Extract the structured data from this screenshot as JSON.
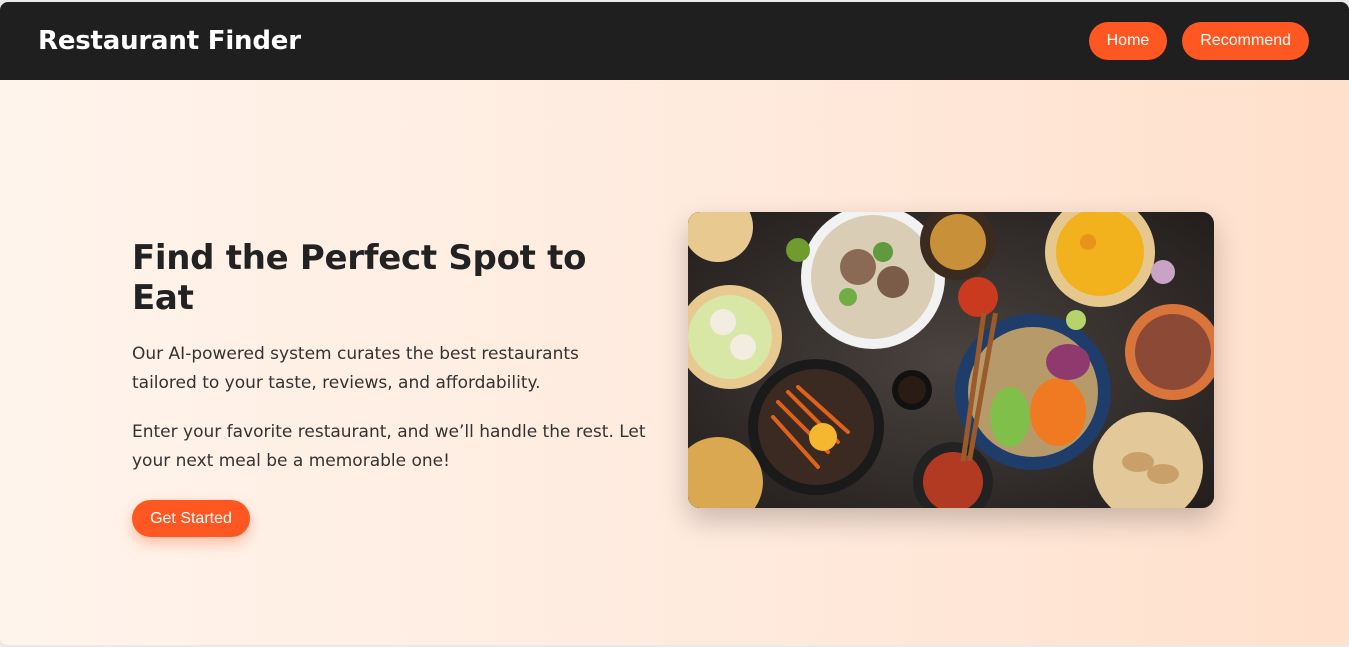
{
  "header": {
    "brand": "Restaurant Finder",
    "nav": [
      {
        "label": "Home"
      },
      {
        "label": "Recommend"
      }
    ]
  },
  "hero": {
    "title": "Find the Perfect Spot to Eat",
    "paragraphs": [
      "Our AI-powered system curates the best restaurants tailored to your taste, reviews, and affordability.",
      "Enter your favorite restaurant, and we’ll handle the rest. Let your next meal be a memorable one!"
    ],
    "cta_label": "Get Started"
  },
  "colors": {
    "accent": "#ff5722",
    "navbar": "#1f1f1f"
  }
}
